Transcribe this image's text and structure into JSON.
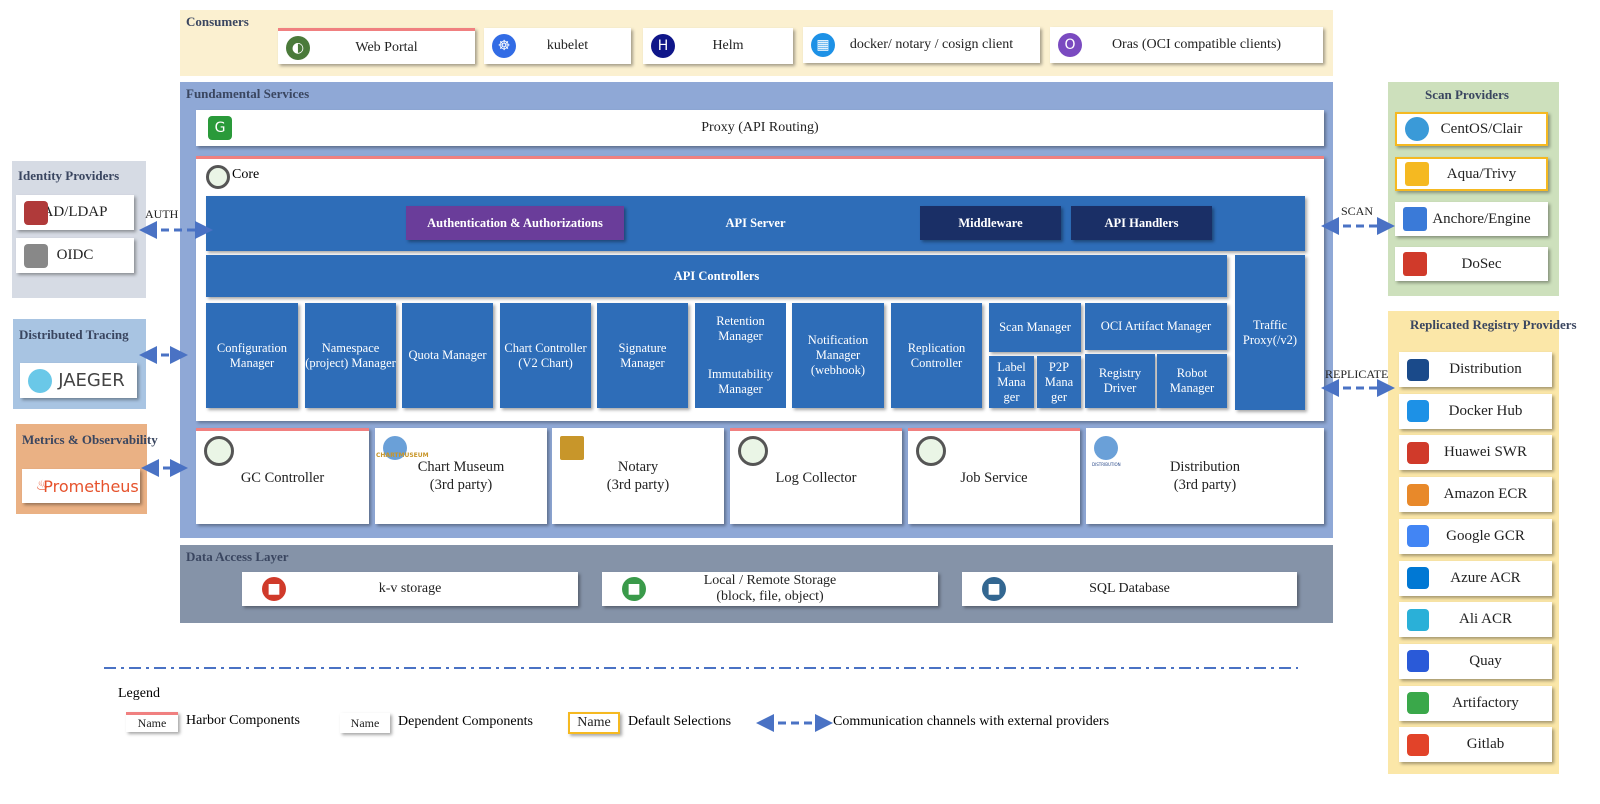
{
  "consumers": {
    "title": "Consumers",
    "items": [
      "Web Portal",
      "kubelet",
      "Helm",
      "docker/ notary / cosign client",
      "Oras (OCI compatible clients)"
    ],
    "oras_logo": "ORAS",
    "helm_logo": "HELM"
  },
  "fundamental": {
    "title": "Fundamental Services",
    "proxy": "Proxy (API Routing)",
    "core": "Core",
    "api_server": "API Server",
    "auth": "Authentication & Authorizations",
    "middleware": "Middleware",
    "api_handlers": "API Handlers",
    "api_controllers": "API Controllers",
    "traffic_proxy": "Traffic Proxy(/v2)",
    "managers": [
      "Configuration Manager",
      "Namespace (project) Manager",
      "Quota Manager",
      "Chart Controller (V2 Chart)",
      "Signature Manager",
      "Retention Manager",
      "Immutability Manager",
      "Notification Manager (webhook)",
      "Replication Controller",
      "Scan Manager",
      "Label Mana ger",
      "P2P Mana ger",
      "OCI Artifact Manager",
      "Registry Driver",
      "Robot Manager"
    ],
    "services": [
      "GC Controller",
      "Chart Museum",
      "(3rd party)",
      "Notary",
      "(3rd party)",
      "Log Collector",
      "Job Service",
      "Distribution",
      "(3rd party)"
    ],
    "chartmuseum_logo": "CHARTMUSEUM",
    "distribution_logo": "DISTRIBUTION"
  },
  "data_access": {
    "title": "Data Access Layer",
    "items": [
      "k-v storage",
      "Local / Remote Storage (block, file, object)",
      "SQL Database"
    ]
  },
  "identity": {
    "title": "Identity Providers",
    "items": [
      "AD/LDAP",
      "OIDC"
    ],
    "ldap_logo": "LDAP"
  },
  "tracing": {
    "title": "Distributed Tracing",
    "item": "JAEGER"
  },
  "metrics": {
    "title": "Metrics & Observability",
    "item": "Prometheus"
  },
  "scan": {
    "title": "Scan Providers",
    "items": [
      "CentOS/Clair",
      "Aqua/Trivy",
      "Anchore/Engine",
      "DoSec"
    ],
    "anchore_logo": "anchore"
  },
  "replicated": {
    "title": "Replicated Registry Providers",
    "items": [
      "Distribution",
      "Docker Hub",
      "Huawei SWR",
      "Amazon ECR",
      "Google GCR",
      "Azure ACR",
      "Ali ACR",
      "Quay",
      "Artifactory",
      "Gitlab"
    ]
  },
  "channels": {
    "auth": "AUTH",
    "scan": "SCAN",
    "replicate": "REPLICATE"
  },
  "legend": {
    "title": "Legend",
    "sample": "Name",
    "harbor": "Harbor Components",
    "dependent": "Dependent Components",
    "default": "Default Selections",
    "channels": "Communication channels with external providers"
  },
  "colors": {
    "harbor": "#f08080",
    "default": "#f5b921",
    "core_blue": "#2e6db8",
    "auth_purple": "#6a3d9a",
    "dark_navy": "#1a2f66",
    "arrow": "#4a72c4"
  }
}
